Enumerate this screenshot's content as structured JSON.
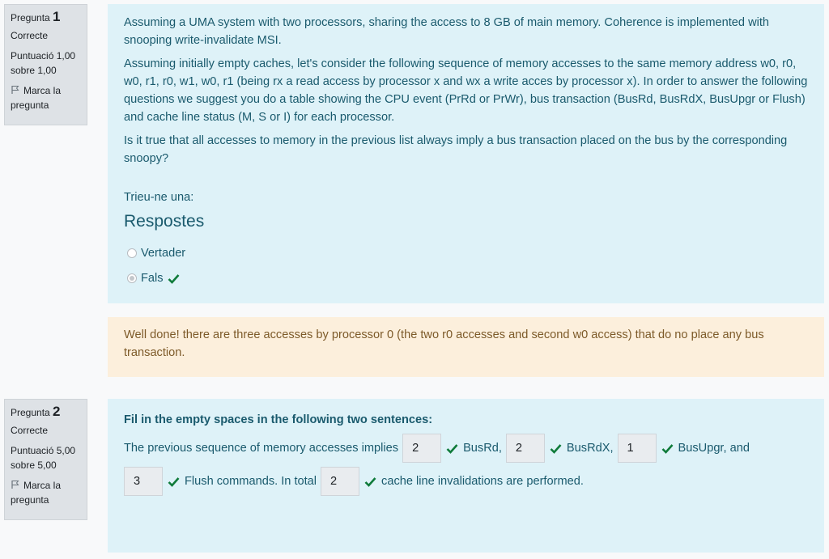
{
  "q1": {
    "label": "Pregunta",
    "number": "1",
    "status": "Correcte",
    "score_line1": "Puntuació 1,00",
    "score_line2": "sobre 1,00",
    "flag_line1": "Marca la",
    "flag_line2": "pregunta",
    "para1": "Assuming a UMA system with two processors, sharing the access to 8 GB of main memory. Coherence is implemented with snooping write-invalidate MSI.",
    "para2": "Assuming initially empty caches, let's consider the following sequence of memory accesses to the same memory address w0, r0, w0, r1, r0, w1, w0, r1 (being rx a read access by processor x and wx a write acces by processor x). In order to answer the following questions we suggest you do a table showing the CPU event (PrRd or PrWr), bus transaction (BusRd, BusRdX, BusUpgr or Flush) and cache line status (M, S or I) for each processor.",
    "para3": "Is it true that all accesses to memory in the previous list always imply a bus transaction placed on the bus by the corresponding snoopy?",
    "prompt": "Trieu-ne una:",
    "answers_heading": "Respostes",
    "options": [
      {
        "label": "Vertader",
        "selected": false,
        "correct": false
      },
      {
        "label": "Fals",
        "selected": true,
        "correct": true
      }
    ],
    "feedback": "Well done! there are three accesses by processor 0 (the two r0 accesses and second w0 access) that do no place any bus transaction."
  },
  "q2": {
    "label": "Pregunta",
    "number": "2",
    "status": "Correcte",
    "score_line1": "Puntuació 5,00",
    "score_line2": "sobre 5,00",
    "flag_line1": "Marca la",
    "flag_line2": "pregunta",
    "title": "Fil in the empty spaces in the following two sentences:",
    "sentence_start": "The previous sequence of memory accesses implies",
    "gap1": "2",
    "after1": "BusRd,",
    "gap2": "2",
    "after2": "BusRdX,",
    "gap3": "1",
    "after3": "BusUpgr, and",
    "gap4": "3",
    "after4": "Flush commands. In total",
    "gap5": "2",
    "after5": "cache line invalidations are performed."
  },
  "colors": {
    "formulation_bg": "#def2f8",
    "feedback_bg": "#fcefdc",
    "correct_green": "#0f7b3a",
    "info_bg": "#dee2e6"
  },
  "icons": {
    "flag": "flag-icon",
    "check": "check-icon"
  }
}
